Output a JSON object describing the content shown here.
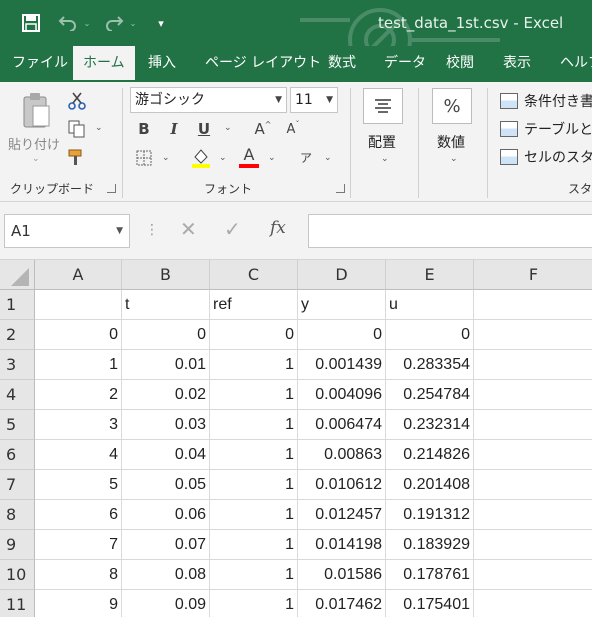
{
  "window": {
    "title": "test_data_1st.csv - Excel"
  },
  "quick_access": {
    "save_icon": "save-icon",
    "undo_icon": "undo-icon",
    "redo_icon": "redo-icon",
    "customize_icon": "customize-icon"
  },
  "tabs": [
    {
      "label": "ファイル",
      "active": false
    },
    {
      "label": "ホーム",
      "active": true
    },
    {
      "label": "挿入",
      "active": false
    },
    {
      "label": "ページ レイアウト",
      "active": false
    },
    {
      "label": "数式",
      "active": false
    },
    {
      "label": "データ",
      "active": false
    },
    {
      "label": "校閲",
      "active": false
    },
    {
      "label": "表示",
      "active": false
    },
    {
      "label": "ヘルプ",
      "active": false
    }
  ],
  "ribbon": {
    "clipboard": {
      "paste_label": "貼り付け",
      "group_label": "クリップボード"
    },
    "font": {
      "font_name": "游ゴシック",
      "font_size": "11",
      "bold": "B",
      "italic": "I",
      "underline": "U",
      "grow": "A",
      "shrink": "A",
      "font_color_letter": "A",
      "phonetic_letter": "ア",
      "group_label": "フォント"
    },
    "alignment": {
      "label": "配置"
    },
    "number": {
      "label": "数値",
      "icon_text": "%"
    },
    "styles": {
      "items": [
        "条件付き書式",
        "テーブルとして書式設定",
        "セルのスタイル"
      ],
      "group_label": "スタイル"
    }
  },
  "formula_bar": {
    "name_box": "A1",
    "fx": "fx",
    "formula": ""
  },
  "sheet": {
    "columns": [
      "A",
      "B",
      "C",
      "D",
      "E",
      "F"
    ],
    "rows": [
      {
        "row": "1",
        "cells": [
          "",
          "t",
          "ref",
          "y",
          "u",
          ""
        ]
      },
      {
        "row": "2",
        "cells": [
          "0",
          "0",
          "0",
          "0",
          "0",
          ""
        ]
      },
      {
        "row": "3",
        "cells": [
          "1",
          "0.01",
          "1",
          "0.001439",
          "0.283354",
          ""
        ]
      },
      {
        "row": "4",
        "cells": [
          "2",
          "0.02",
          "1",
          "0.004096",
          "0.254784",
          ""
        ]
      },
      {
        "row": "5",
        "cells": [
          "3",
          "0.03",
          "1",
          "0.006474",
          "0.232314",
          ""
        ]
      },
      {
        "row": "6",
        "cells": [
          "4",
          "0.04",
          "1",
          "0.00863",
          "0.214826",
          ""
        ]
      },
      {
        "row": "7",
        "cells": [
          "5",
          "0.05",
          "1",
          "0.010612",
          "0.201408",
          ""
        ]
      },
      {
        "row": "8",
        "cells": [
          "6",
          "0.06",
          "1",
          "0.012457",
          "0.191312",
          ""
        ]
      },
      {
        "row": "9",
        "cells": [
          "7",
          "0.07",
          "1",
          "0.014198",
          "0.183929",
          ""
        ]
      },
      {
        "row": "10",
        "cells": [
          "8",
          "0.08",
          "1",
          "0.01586",
          "0.178761",
          ""
        ]
      },
      {
        "row": "11",
        "cells": [
          "9",
          "0.09",
          "1",
          "0.017462",
          "0.175401",
          ""
        ]
      }
    ]
  },
  "colors": {
    "accent": "#217346",
    "ribbon_bg": "#f3f3f3",
    "header_bg": "#e6e6e6",
    "fill_color": "#ffff00",
    "font_color": "#ff0000"
  }
}
